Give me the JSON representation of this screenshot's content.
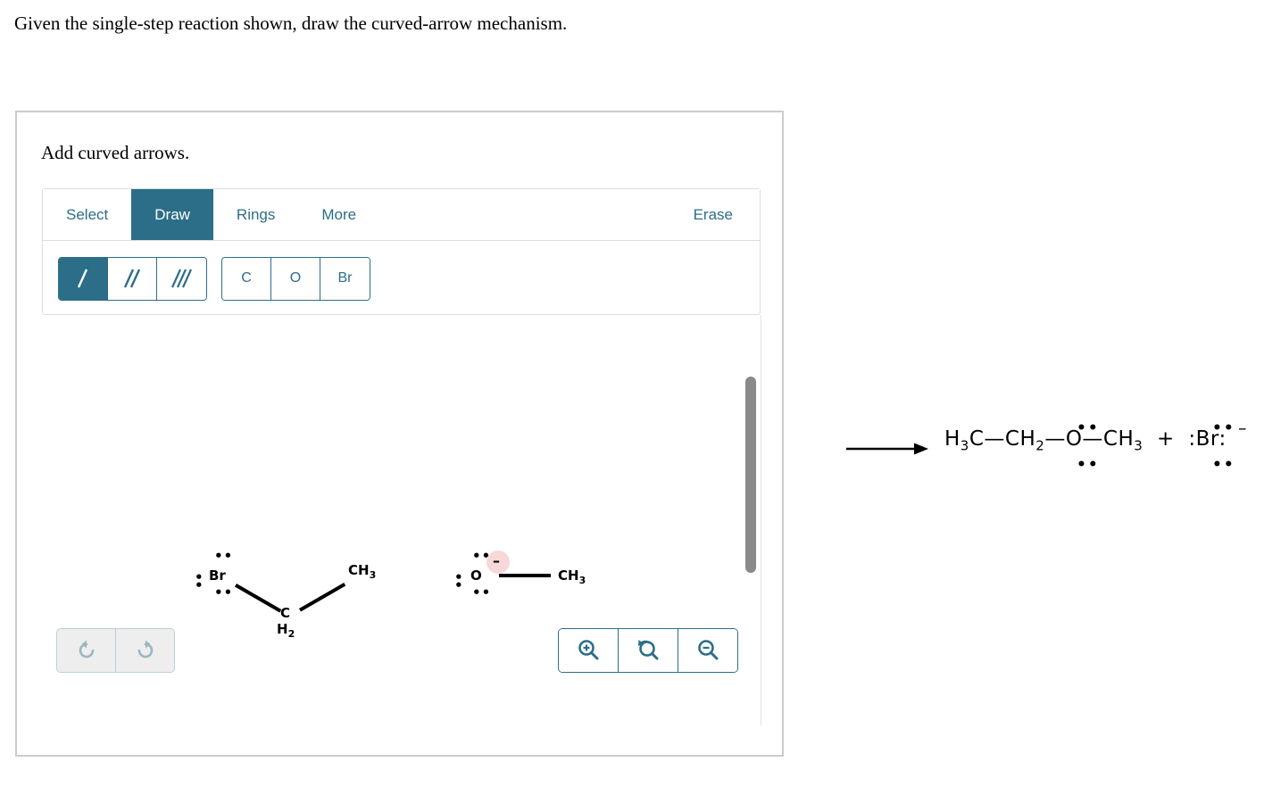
{
  "question": {
    "prompt": "Given the single-step reaction shown, draw the curved-arrow mechanism."
  },
  "sketcher": {
    "instruction": "Add curved arrows.",
    "tabs": [
      {
        "label": "Select",
        "active": false
      },
      {
        "label": "Draw",
        "active": true
      },
      {
        "label": "Rings",
        "active": false
      },
      {
        "label": "More",
        "active": false
      }
    ],
    "erase_label": "Erase",
    "bond_tools": [
      {
        "name": "single-bond",
        "icon": "single-bond-icon",
        "active": true
      },
      {
        "name": "double-bond",
        "icon": "double-bond-icon",
        "active": false
      },
      {
        "name": "triple-bond",
        "icon": "triple-bond-icon",
        "active": false
      }
    ],
    "element_tools": [
      {
        "label": "C",
        "active": false
      },
      {
        "label": "O",
        "active": false
      },
      {
        "label": "Br",
        "active": false
      }
    ],
    "history_buttons": [
      {
        "name": "undo-button",
        "icon": "undo-icon"
      },
      {
        "name": "redo-button",
        "icon": "redo-icon"
      }
    ],
    "zoom_buttons": [
      {
        "name": "zoom-in-button",
        "icon": "zoom-in-icon"
      },
      {
        "name": "zoom-reset-button",
        "icon": "zoom-reset-icon"
      },
      {
        "name": "zoom-out-button",
        "icon": "zoom-out-icon"
      }
    ],
    "canvas": {
      "reactant_1": {
        "name": "bromoethane",
        "br_label": "Br",
        "ch2_label_c": "C",
        "ch2_label_h": "H",
        "ch2_sub": "2",
        "ch3_label": "CH",
        "ch3_sub": "3"
      },
      "reactant_2": {
        "name": "methoxide",
        "o_label": "O",
        "charge": "–",
        "ch3_label": "CH",
        "ch3_sub": "3",
        "charge_highlight_color": "#f7d7d7"
      }
    }
  },
  "reaction": {
    "arrow": "reaction-arrow",
    "product_part_1": "H",
    "product_sub_1": "3",
    "product_part_2": "C",
    "product_bond_1": "—",
    "product_part_3": "CH",
    "product_sub_2": "2",
    "product_bond_2": "—",
    "product_part_4": "O",
    "product_bond_3": "—",
    "product_part_5": "CH",
    "product_sub_3": "3",
    "plus": "+",
    "bromide_label": "Br",
    "bromide_charge": "–",
    "full_text": "H3C—CH2—O—CH3 + :Br:⁻"
  },
  "colors": {
    "accent": "#2c6e87",
    "panel_border": "#cccccc",
    "toolbar_border": "#dddddd",
    "scrollbar": "#8a8a8a",
    "charge_highlight": "#f7d7d7",
    "history_bg": "#eeeeee",
    "history_icon": "#9cb7c2"
  }
}
